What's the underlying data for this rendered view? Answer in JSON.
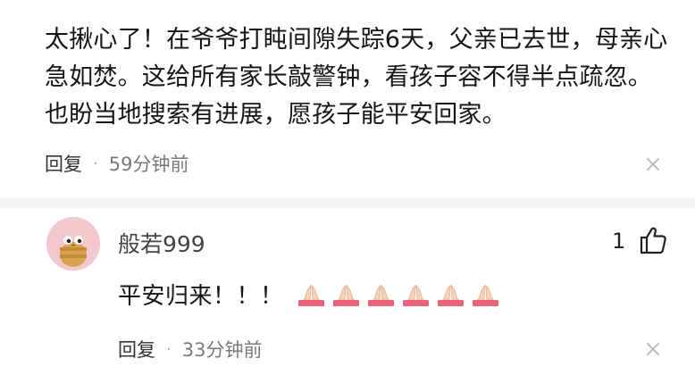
{
  "comment1": {
    "text": "太揪心了！在爷爷打盹间隙失踪6天，父亲已去世，母亲心急如焚。这给所有家长敲警钟，看孩子容不得半点疏忽。也盼当地搜索有进展，愿孩子能平安回家。",
    "reply_label": "回复",
    "separator": "·",
    "time": "59分钟前"
  },
  "comment2": {
    "username": "般若999",
    "likes": "1",
    "text": "平安归来！！！",
    "emojis": [
      "folded-hands",
      "folded-hands",
      "folded-hands",
      "folded-hands",
      "folded-hands",
      "folded-hands"
    ],
    "reply_label": "回复",
    "separator": "·",
    "time": "33分钟前"
  },
  "icons": {
    "close": "close-icon",
    "like": "thumbs-up-icon",
    "emoji": "folded-hands-icon"
  },
  "colors": {
    "text": "#151515",
    "meta": "#7a7a7a",
    "avatar_bg": "#f4c7cf",
    "separator": "#f4f4f6"
  }
}
